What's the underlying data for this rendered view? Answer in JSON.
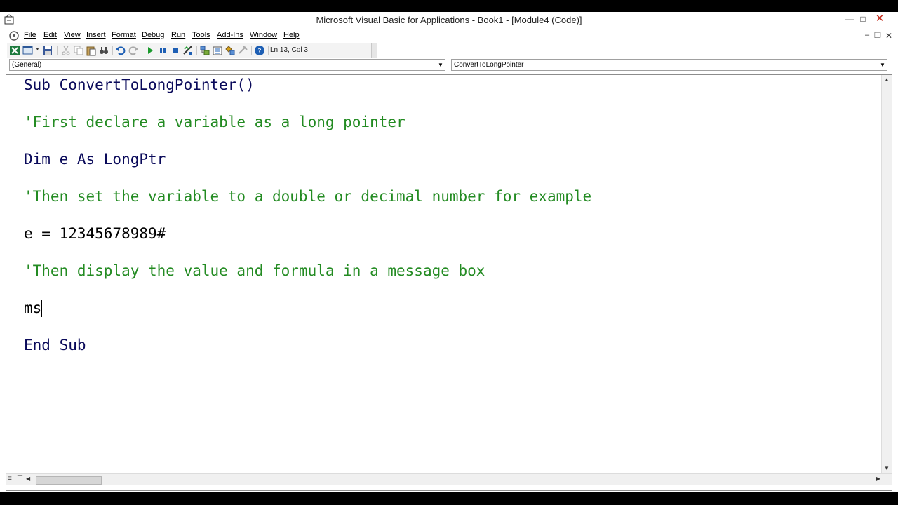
{
  "window": {
    "title": "Microsoft Visual Basic for Applications - Book1 - [Module4 (Code)]"
  },
  "menu": [
    {
      "label": "File",
      "name": "menu-file"
    },
    {
      "label": "Edit",
      "name": "menu-edit"
    },
    {
      "label": "View",
      "name": "menu-view"
    },
    {
      "label": "Insert",
      "name": "menu-insert"
    },
    {
      "label": "Format",
      "name": "menu-format"
    },
    {
      "label": "Debug",
      "name": "menu-debug"
    },
    {
      "label": "Run",
      "name": "menu-run"
    },
    {
      "label": "Tools",
      "name": "menu-tools"
    },
    {
      "label": "Add-Ins",
      "name": "menu-addins"
    },
    {
      "label": "Window",
      "name": "menu-window"
    },
    {
      "label": "Help",
      "name": "menu-help"
    }
  ],
  "toolbar": {
    "status": "Ln 13, Col 3"
  },
  "combos": {
    "object": "(General)",
    "procedure": "ConvertToLongPointer"
  },
  "code": {
    "l1": "Sub ConvertToLongPointer()",
    "l2": "'First declare a variable as a long pointer",
    "l3": "Dim e As LongPtr",
    "l4": "'Then set the variable to a double or decimal number for example",
    "l5": "e = 12345678989#",
    "l6": "'Then display the value and formula in a message box",
    "l7": "ms",
    "l8": "End Sub"
  },
  "colors": {
    "keyword": "#0a0a5a",
    "comment": "#238b22"
  },
  "icons": {
    "app": "vba-app-icon",
    "excel": "excel-icon",
    "run": "run-icon",
    "help": "help-icon"
  }
}
